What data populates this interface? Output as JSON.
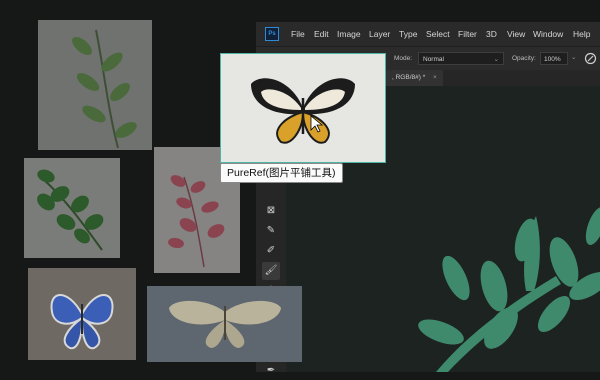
{
  "ps": {
    "logo": "Ps",
    "menus": [
      "File",
      "Edit",
      "Image",
      "Layer",
      "Type",
      "Select",
      "Filter",
      "3D",
      "View",
      "Window",
      "Help"
    ],
    "options": {
      "mode_label": "Mode:",
      "mode_value": "Normal",
      "opacity_label": "Opacity:",
      "opacity_value": "100%"
    },
    "doc_tab": ", RGB/8#) *",
    "tools": [
      "frame-tool",
      "eyedropper-tool",
      "healing-brush-tool",
      "brush-tool",
      "clone-stamp-tool",
      "history-brush-tool",
      "eraser-tool",
      "gradient-tool",
      "blur-tool",
      "dodge-tool",
      "pen-tool"
    ]
  },
  "tooltip": {
    "text": "PureRef(图片平铺工具)"
  },
  "references": [
    {
      "name": "ref-leaf-branch",
      "subject": "leafy branch"
    },
    {
      "name": "ref-green-sprig",
      "subject": "green sprig"
    },
    {
      "name": "ref-pink-leaves",
      "subject": "pink leaves"
    },
    {
      "name": "ref-butterfly-yellow",
      "subject": "yellow butterfly"
    },
    {
      "name": "ref-blue-butterfly",
      "subject": "blue butterfly"
    },
    {
      "name": "ref-white-moth",
      "subject": "white moth"
    }
  ],
  "colors": {
    "leaf_green": "#3f8a6c",
    "canvas_bg": "#1c2321",
    "selection_border": "#4fb3a8"
  }
}
